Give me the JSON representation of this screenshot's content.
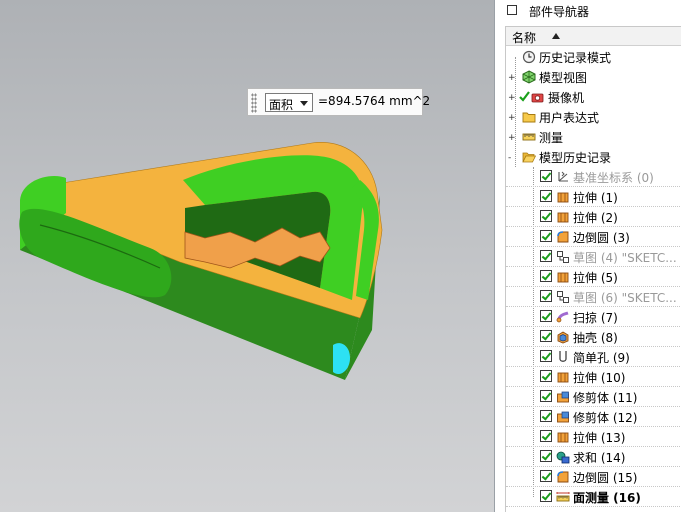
{
  "measure": {
    "type_label": "面积",
    "value_text": "=894.5764 mm^2"
  },
  "navigator": {
    "title": "部件导航器",
    "column_header": "名称",
    "top_nodes": [
      {
        "label": "历史记录模式",
        "expander": "",
        "icon": "clock-icon"
      },
      {
        "label": "模型视图",
        "expander": "+",
        "icon": "model-views-icon"
      },
      {
        "label": "摄像机",
        "expander": "+",
        "icon": "camera-icon"
      },
      {
        "label": "用户表达式",
        "expander": "+",
        "icon": "folder-icon"
      },
      {
        "label": "测量",
        "expander": "+",
        "icon": "measure-icon"
      },
      {
        "label": "模型历史记录",
        "expander": "-",
        "icon": "open-folder-icon"
      }
    ],
    "features": [
      {
        "label": "基准坐标系 (0)",
        "icon": "datum-csys-icon",
        "grayed": true,
        "bold": false
      },
      {
        "label": "拉伸 (1)",
        "icon": "extrude-icon",
        "grayed": false,
        "bold": false
      },
      {
        "label": "拉伸 (2)",
        "icon": "extrude-icon",
        "grayed": false,
        "bold": false
      },
      {
        "label": "边倒圆 (3)",
        "icon": "edge-blend-icon",
        "grayed": false,
        "bold": false
      },
      {
        "label": "草图 (4) \"SKETC...",
        "icon": "sketch-icon",
        "grayed": true,
        "bold": false
      },
      {
        "label": "拉伸 (5)",
        "icon": "extrude-icon",
        "grayed": false,
        "bold": false
      },
      {
        "label": "草图 (6) \"SKETC...",
        "icon": "sketch-icon",
        "grayed": true,
        "bold": false
      },
      {
        "label": "扫掠 (7)",
        "icon": "swept-icon",
        "grayed": false,
        "bold": false
      },
      {
        "label": "抽壳 (8)",
        "icon": "shell-icon",
        "grayed": false,
        "bold": false
      },
      {
        "label": "简单孔 (9)",
        "icon": "hole-icon",
        "grayed": false,
        "bold": false
      },
      {
        "label": "拉伸 (10)",
        "icon": "extrude-icon",
        "grayed": false,
        "bold": false
      },
      {
        "label": "修剪体 (11)",
        "icon": "trim-body-icon",
        "grayed": false,
        "bold": false
      },
      {
        "label": "修剪体 (12)",
        "icon": "trim-body-icon",
        "grayed": false,
        "bold": false
      },
      {
        "label": "拉伸 (13)",
        "icon": "extrude-icon",
        "grayed": false,
        "bold": false
      },
      {
        "label": "求和 (14)",
        "icon": "unite-icon",
        "grayed": false,
        "bold": false
      },
      {
        "label": "边倒圆 (15)",
        "icon": "edge-blend-icon",
        "grayed": false,
        "bold": false
      },
      {
        "label": "面测量 (16)",
        "icon": "face-measure-icon",
        "grayed": false,
        "bold": true
      }
    ]
  }
}
